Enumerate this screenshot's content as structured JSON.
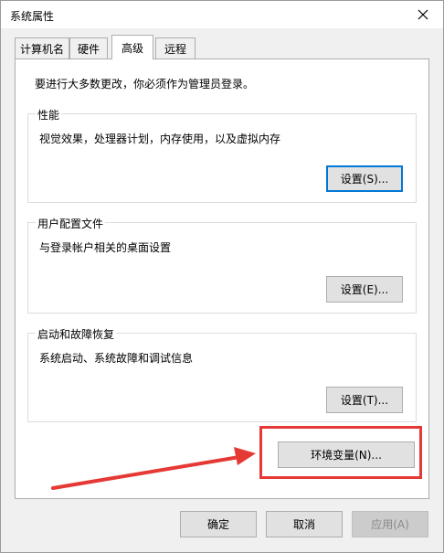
{
  "window": {
    "title": "系统属性"
  },
  "tabs": [
    {
      "label": "计算机名"
    },
    {
      "label": "硬件"
    },
    {
      "label": "高级"
    },
    {
      "label": "远程"
    }
  ],
  "active_tab": "高级",
  "advanced": {
    "admin_note": "要进行大多数更改，你必须作为管理员登录。",
    "performance": {
      "title": "性能",
      "description": "视觉效果，处理器计划，内存使用，以及虚拟内存",
      "button": "设置(S)..."
    },
    "user_profiles": {
      "title": "用户配置文件",
      "description": "与登录帐户相关的桌面设置",
      "button": "设置(E)..."
    },
    "startup_recovery": {
      "title": "启动和故障恢复",
      "description": "系统启动、系统故障和调试信息",
      "button": "设置(T)..."
    },
    "env_button": "环境变量(N)..."
  },
  "footer": {
    "ok": "确定",
    "cancel": "取消",
    "apply": "应用(A)"
  },
  "colors": {
    "annotation": "#e53935",
    "focus": "#0078d7"
  }
}
